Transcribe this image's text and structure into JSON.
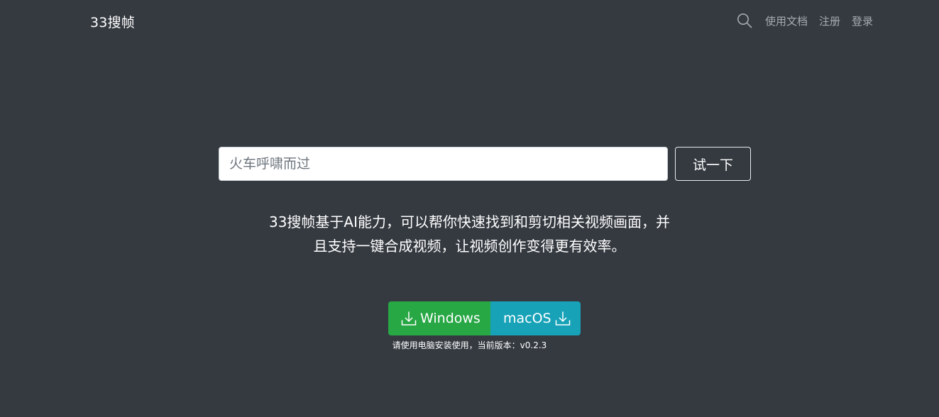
{
  "navbar": {
    "brand": "33搜帧",
    "links": [
      "使用文档",
      "注册",
      "登录"
    ],
    "search_icon": "search-icon"
  },
  "search": {
    "value": "",
    "placeholder": "火车呼啸而过",
    "button_label": "试一下"
  },
  "description": {
    "line1": "33搜帧基于AI能力，可以帮你快速找到和剪切相关视频画面，并",
    "line2": "且支持一键合成视频，让视频创作变得更有效率。"
  },
  "downloads": {
    "windows_label": "Windows",
    "macos_label": "macOS",
    "icon": "download-icon",
    "note": "请使用电脑安装使用，当前版本：v0.2.3"
  },
  "colors": {
    "background": "#353a41",
    "windows_button": "#28a745",
    "macos_button": "#17a2b8",
    "nav_text": "#a7abb1"
  }
}
